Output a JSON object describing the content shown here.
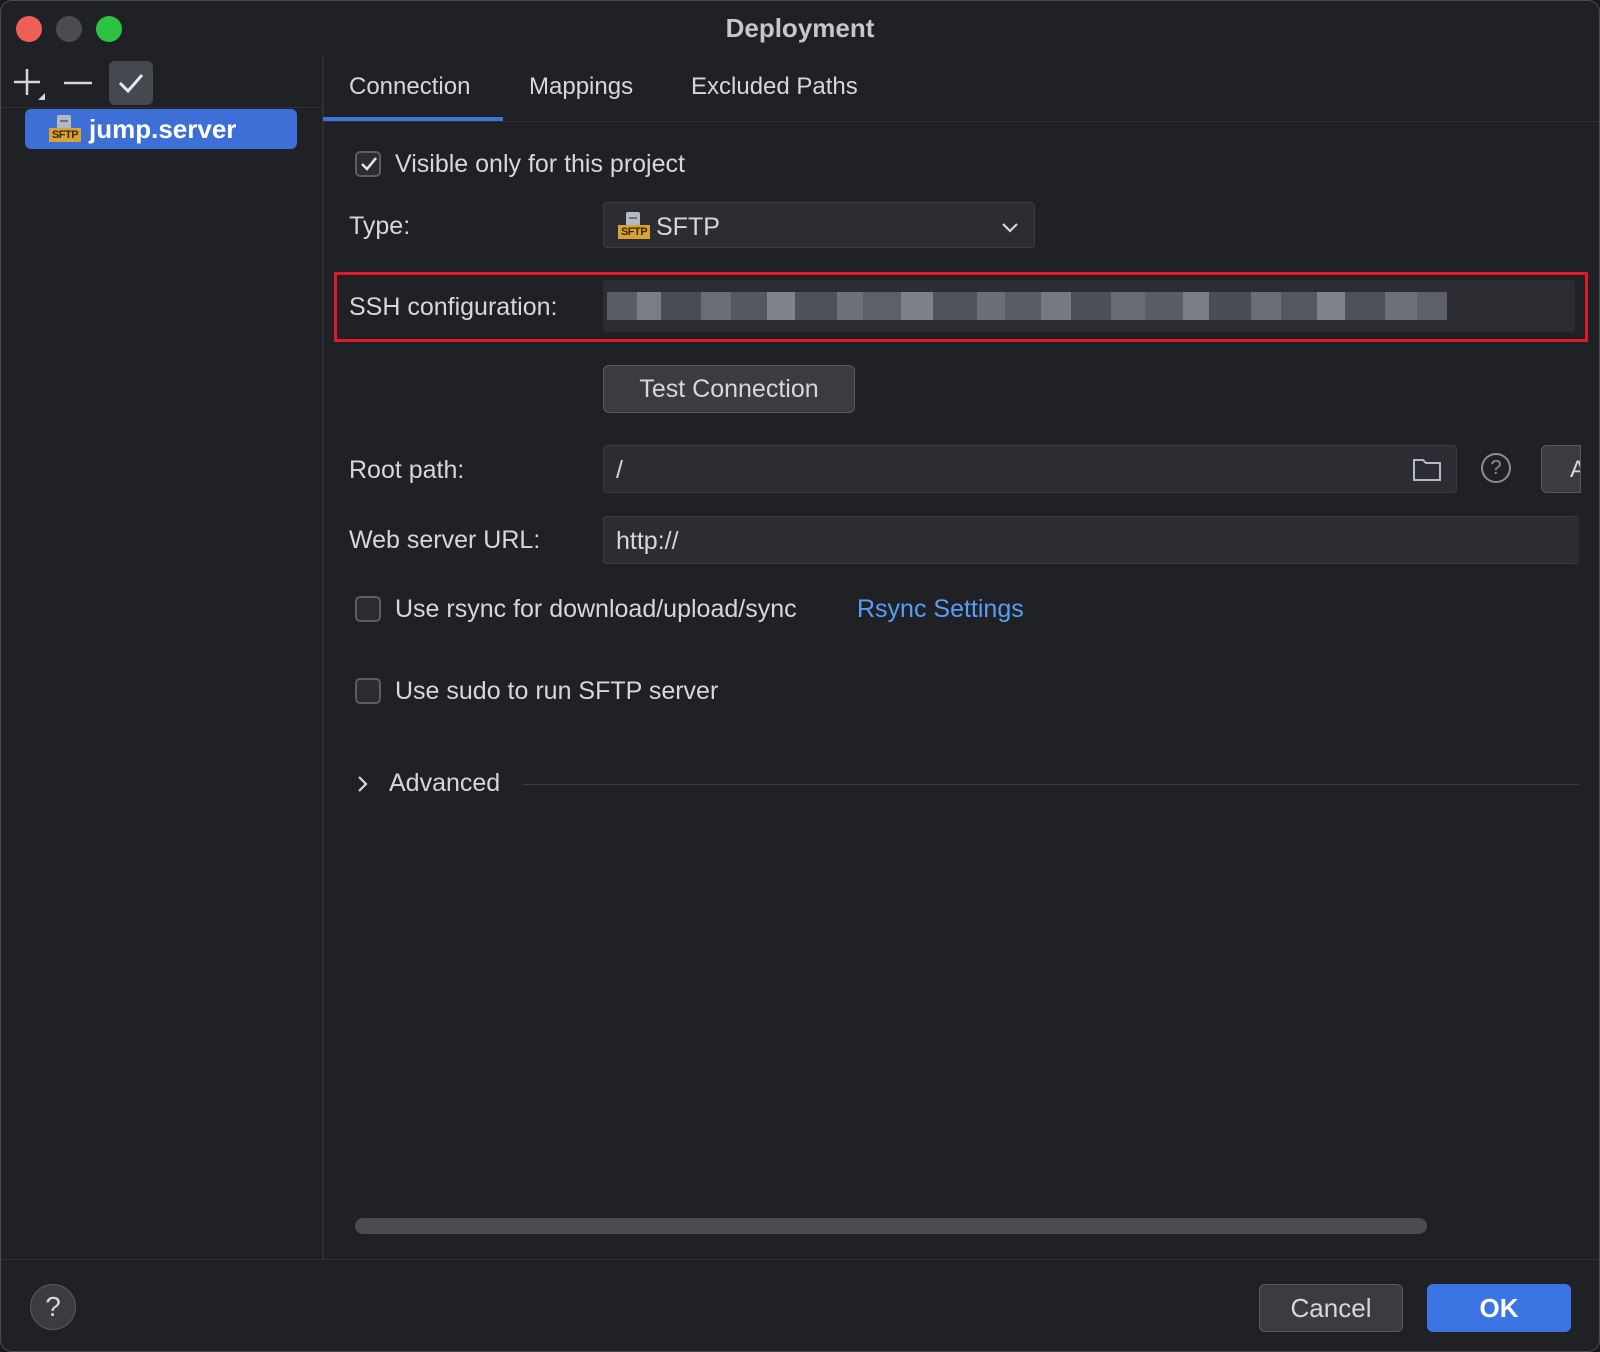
{
  "window": {
    "title": "Deployment"
  },
  "sidebar": {
    "items": [
      {
        "label": "jump.server",
        "icon": "sftp-server-icon",
        "icon_tag": "SFTP"
      }
    ]
  },
  "tabs": [
    {
      "label": "Connection",
      "active": true
    },
    {
      "label": "Mappings"
    },
    {
      "label": "Excluded Paths"
    }
  ],
  "form": {
    "visible_only": {
      "label": "Visible only for this project",
      "checked": true
    },
    "type": {
      "label": "Type:",
      "value": "SFTP",
      "icon_tag": "SFTP"
    },
    "ssh": {
      "label": "SSH configuration:",
      "value_state": "blurred"
    },
    "test_connection": "Test Connection",
    "root_path": {
      "label": "Root path:",
      "value": "/",
      "cut_button_text": "A"
    },
    "web_server_url": {
      "label": "Web server URL:",
      "value": "http://"
    },
    "rsync": {
      "label": "Use rsync for download/upload/sync",
      "checked": false,
      "link": "Rsync Settings"
    },
    "sudo": {
      "label": "Use sudo to run SFTP server",
      "checked": false
    },
    "advanced": {
      "label": "Advanced"
    }
  },
  "footer": {
    "help": "?",
    "cancel": "Cancel",
    "ok": "OK"
  },
  "colors": {
    "accent": "#3d74e3",
    "highlight": "#e0192a",
    "link": "#5b9cf5",
    "background": "#1f2125"
  }
}
